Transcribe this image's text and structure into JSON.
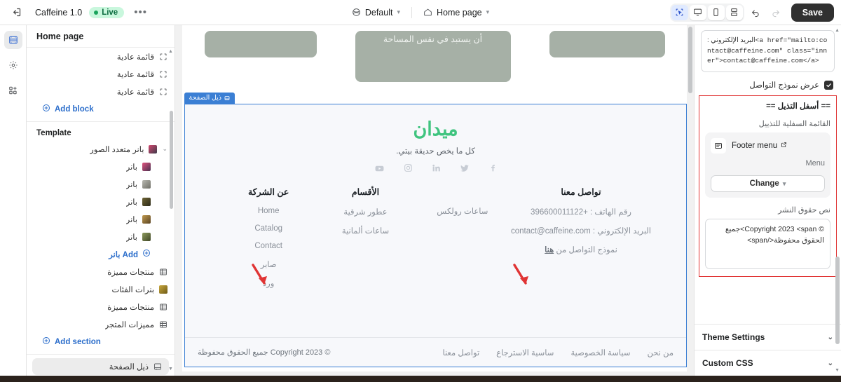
{
  "topbar": {
    "back_icon": "exit-icon",
    "app_name": "Caffeine 1.0",
    "live_label": "Live",
    "more_label": "•••",
    "theme_label": "Default",
    "page_label": "Home page",
    "save_label": "Save"
  },
  "rail": {
    "items": [
      {
        "name": "sections-icon"
      },
      {
        "name": "settings-icon"
      },
      {
        "name": "apps-icon"
      }
    ]
  },
  "left_panel": {
    "title": "Home page",
    "blocks": [
      {
        "label": "قائمة عادية",
        "icon": "block-icon"
      },
      {
        "label": "قائمة عادية",
        "icon": "block-icon"
      },
      {
        "label": "قائمة عادية",
        "icon": "block-icon"
      }
    ],
    "add_block_label": "Add block",
    "template_label": "Template",
    "banner_group": {
      "label": "بانر متعدد الصور",
      "children": [
        {
          "label": "بانر",
          "color": "#d4476e"
        },
        {
          "label": "بانر",
          "color": "#9a9a96"
        },
        {
          "label": "بانر",
          "color": "#5d5533"
        },
        {
          "label": "بانر",
          "color": "#9c7a3c"
        },
        {
          "label": "بانر",
          "color": "#6f7a4a"
        }
      ],
      "add_label": "Add بانر"
    },
    "sections": [
      {
        "label": "منتجات مميزة",
        "icon": "grid-icon"
      },
      {
        "label": "بنرات الفئات",
        "icon": "image-icon"
      },
      {
        "label": "منتجات مميزة",
        "icon": "grid-icon"
      },
      {
        "label": "مميزات المتجر",
        "icon": "grid-icon"
      }
    ],
    "add_section_label": "Add section",
    "footer_item_label": "ذيل الصفحة"
  },
  "canvas": {
    "hero_caption": "أن يستبد في نفس المساحة",
    "selection_tag": "ذيل الصفحة",
    "brand": "ميدان",
    "tagline": "كل ما يخص حديقة بيتي.",
    "socials": [
      "facebook-icon",
      "twitter-icon",
      "linkedin-icon",
      "instagram-icon",
      "youtube-icon"
    ],
    "columns": [
      {
        "heading": "عن الشركة",
        "items": [
          "Home",
          "Catalog",
          "Contact",
          "صابر",
          "ورد"
        ]
      },
      {
        "heading": "الأقسام",
        "items": [
          "عطور شرقية",
          "ساعات ألمانية"
        ]
      },
      {
        "heading": "",
        "items": [
          "ساعات رولكس"
        ]
      },
      {
        "heading": "تواصل معنا",
        "items": [
          "رقم الهاتف : +396600011122",
          "البريد الإلكتروني : contact@caffeine.com",
          "نموذج التواصل من هنا"
        ],
        "link_word": "هنا"
      }
    ],
    "bottom_links": [
      "من نحن",
      "سياسة الخصوصية",
      "ساسية الاسترجاع",
      "تواصل معنا"
    ],
    "copyright": "© Copyright 2023  جميع الحقوق محفوظة"
  },
  "right_panel": {
    "code_prefix_ar": "البريد الإلكتروني :",
    "code_snippet": "<a href=\"mailto:contact@caffeine.com\" class=\"inner\">contact@caffeine.com</a>",
    "checkbox_label": "عرض نموذج التواصل",
    "checkbox_checked": true,
    "footer_section_title": "== أسفل التذيل ==",
    "menu_label": "القائمة السفلية للتذييل",
    "menu_name": "Footer menu",
    "menu_sub": "Menu",
    "change_label": "Change",
    "copyright_label": "نص حقوق النشر",
    "copyright_value": "© Copyright 2023 <span>جميع الحقوق محفوظة</span>",
    "accordions": [
      "Theme Settings",
      "Custom CSS"
    ],
    "highlight_color": "#e03434"
  }
}
